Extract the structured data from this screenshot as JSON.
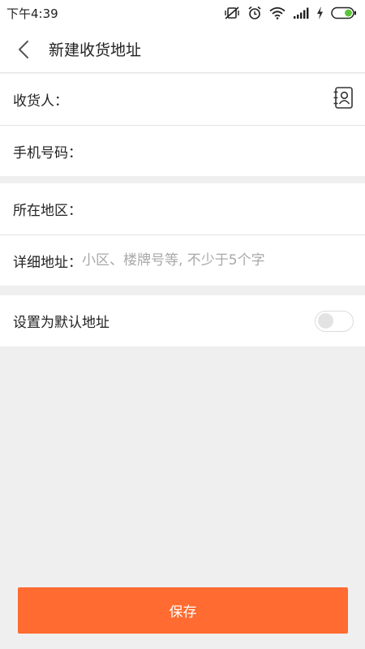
{
  "status_bar": {
    "time": "下午4:39",
    "icons": [
      "muted-vibrate-icon",
      "alarm-icon",
      "wifi-icon",
      "signal-icon",
      "charging-icon",
      "battery-icon"
    ],
    "battery_color": "#5ac53a"
  },
  "nav": {
    "back_icon": "chevron-left-icon",
    "title": "新建收货地址"
  },
  "form": {
    "recipient_label": "收货人：",
    "recipient_value": "",
    "contact_icon": "contact-book-icon",
    "phone_label": "手机号码：",
    "phone_value": "",
    "region_label": "所在地区：",
    "region_value": "",
    "detail_label": "详细地址：",
    "detail_placeholder": "小区、楼牌号等, 不少于5个字",
    "detail_value": "",
    "default_label": "设置为默认地址",
    "default_enabled": false
  },
  "save_button": {
    "label": "保存",
    "color": "#ff6b30"
  }
}
